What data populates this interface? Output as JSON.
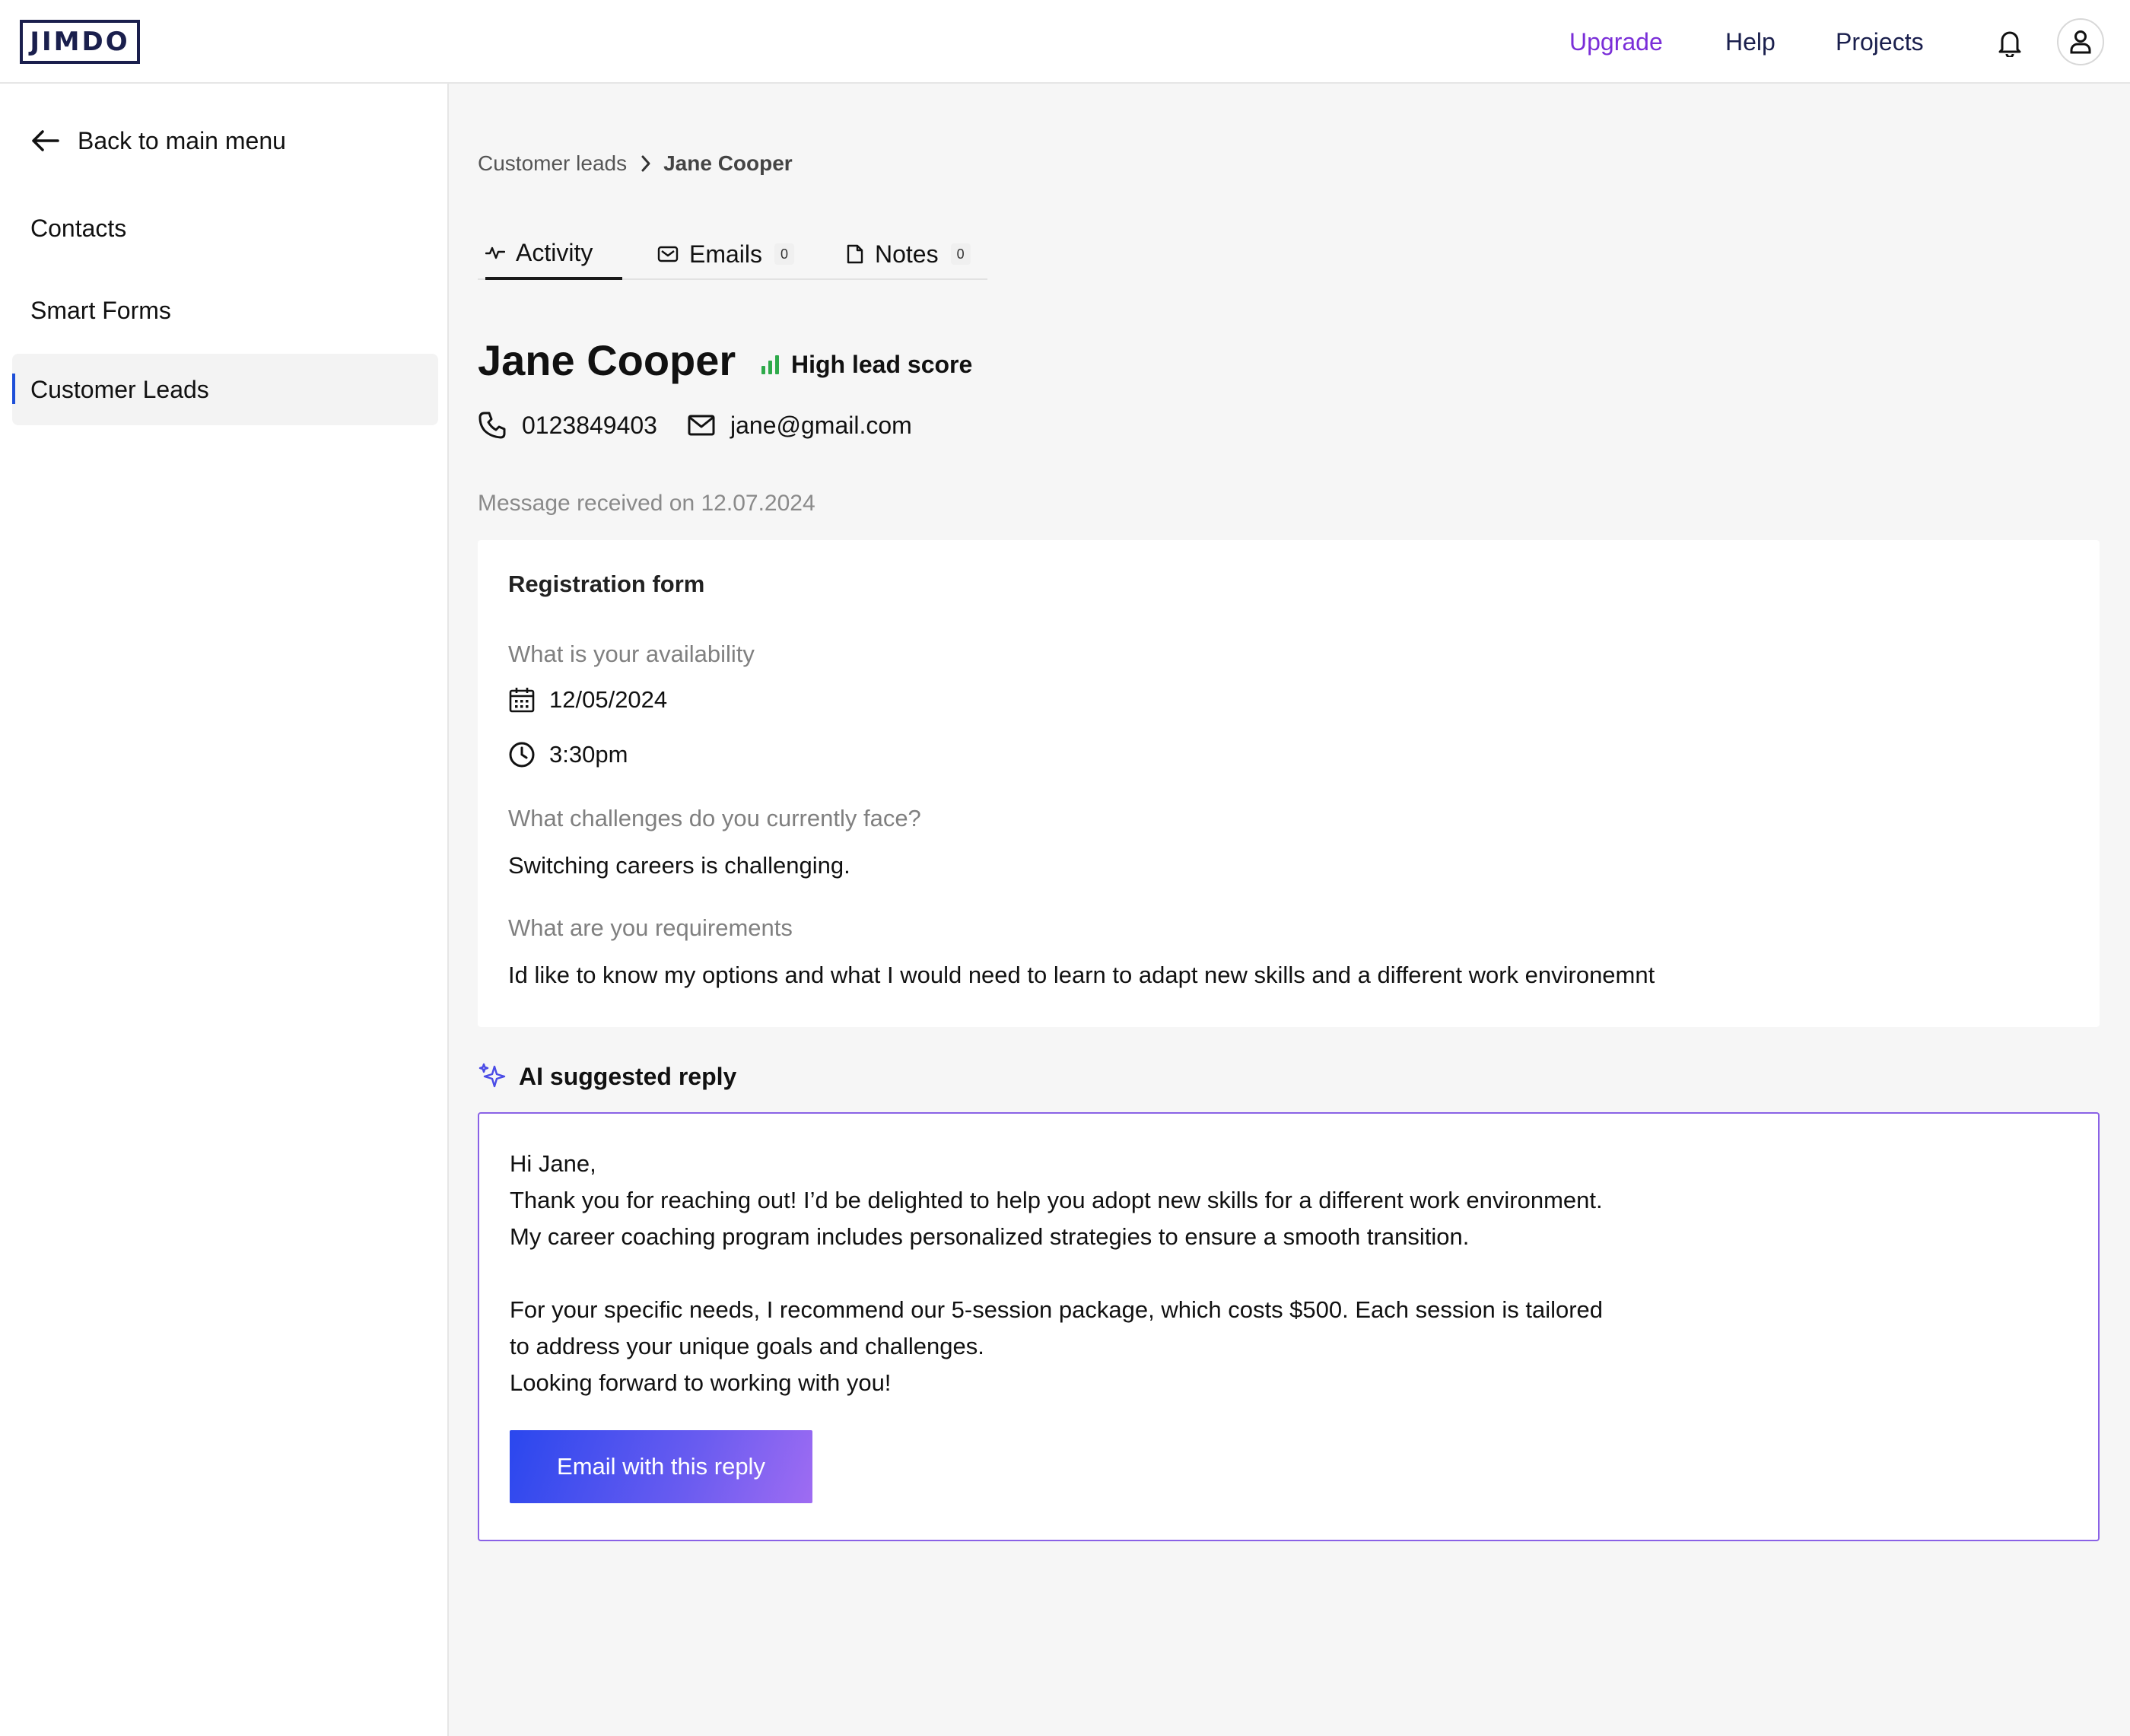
{
  "header": {
    "logo": "JIMDO",
    "nav": {
      "upgrade": "Upgrade",
      "help": "Help",
      "projects": "Projects"
    },
    "icons": {
      "notifications": "bell-icon",
      "account": "user-icon"
    }
  },
  "sidebar": {
    "back_label": "Back to main menu",
    "items": [
      {
        "label": "Contacts",
        "active": false
      },
      {
        "label": "Smart Forms",
        "active": false
      },
      {
        "label": "Customer Leads",
        "active": true
      }
    ]
  },
  "breadcrumb": {
    "parent": "Customer leads",
    "current": "Jane Cooper"
  },
  "tabs": [
    {
      "label": "Activity",
      "active": true,
      "icon": "activity-icon"
    },
    {
      "label": "Emails",
      "count": "0",
      "icon": "mail-icon"
    },
    {
      "label": "Notes",
      "count": "0",
      "icon": "note-icon"
    }
  ],
  "lead": {
    "name": "Jane Cooper",
    "score_label": "High lead score",
    "phone": "0123849403",
    "email": "jane@gmail.com",
    "received": "Message received on 12.07.2024"
  },
  "form": {
    "title": "Registration form",
    "q1": "What is your availability",
    "date": "12/05/2024",
    "time": "3:30pm",
    "q2": "What challenges do you currently face?",
    "a2": "Switching careers is challenging.",
    "q3": "What are you requirements",
    "a3": "Id like to know my options and what I would need to learn to adapt new skills and a different work environemnt"
  },
  "ai": {
    "heading": "AI suggested reply",
    "lines": [
      "Hi Jane,",
      "Thank you for reaching out! I’d be delighted to help you adopt new skills for a different work environment.",
      "My career coaching program includes personalized strategies to ensure a smooth transition.",
      "",
      "For your specific needs, I recommend our 5-session package, which costs $500. Each session is tailored",
      "to address your unique goals and challenges.",
      "Looking forward to working with you!"
    ],
    "button": "Email with this reply"
  },
  "colors": {
    "accent_purple": "#7a2ed8",
    "navy": "#1a1f4d",
    "active_blue": "#1e4fd8",
    "score_green": "#2eaa4a",
    "ai_border": "#8a62e6"
  }
}
